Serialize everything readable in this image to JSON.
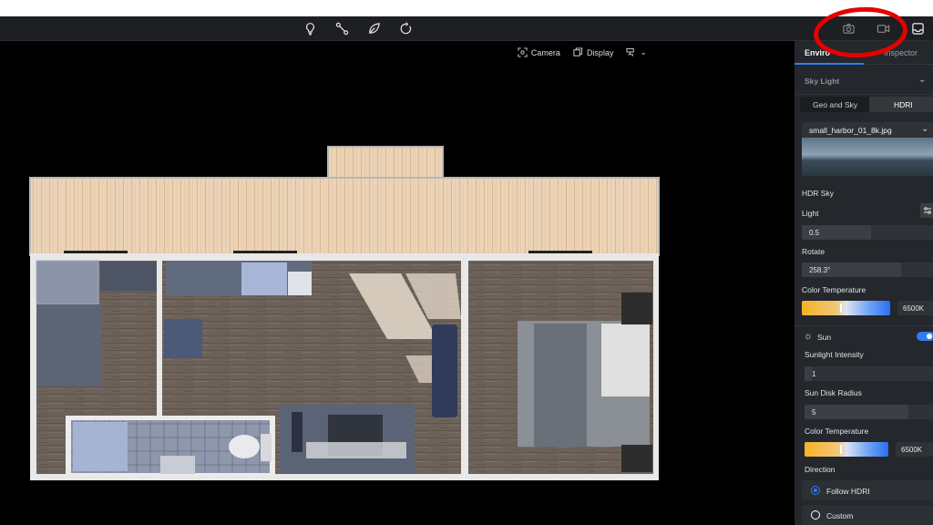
{
  "toolbar": {
    "icons": [
      "lightbulb-icon",
      "path-icon",
      "leaf-icon",
      "rotate-icon",
      "camera-icon",
      "video-icon",
      "inbox-icon"
    ]
  },
  "viewport_tools": {
    "camera_label": "Camera",
    "display_label": "Display"
  },
  "panel": {
    "tab_environment": "Enviro",
    "tab_inspector": "Inspector",
    "sky_light": {
      "title": "Sky Light",
      "subtab_geo": "Geo and Sky",
      "subtab_hdri": "HDRI",
      "hdri_file": "small_harbor_01_8k.jpg",
      "hdr_sky_label": "HDR Sky",
      "light_label": "Light",
      "light_value": "0.5",
      "light_fraction": 0.5,
      "rotate_label": "Rotate",
      "rotate_value": "258.3°",
      "rotate_fraction": 0.72,
      "color_temp_label": "Color Temperature",
      "color_temp_value": "6500K",
      "color_temp_fraction": 0.44
    },
    "sun": {
      "title": "Sun",
      "enabled": true,
      "intensity_label": "Sunlight Intensity",
      "intensity_value": "1",
      "intensity_fraction": 0.05,
      "disk_radius_label": "Sun Disk Radius",
      "disk_radius_value": "5",
      "disk_radius_fraction": 0.75,
      "color_temp_label": "Color Temperature",
      "color_temp_value": "6500K",
      "color_temp_fraction": 0.44,
      "direction_label": "Direction",
      "option_follow": "Follow HDRI",
      "option_custom": "Custom",
      "selected_option": "Follow HDRI"
    }
  },
  "colors": {
    "accent": "#2f7df6",
    "annotation": "#e60000",
    "panel_bg": "#24272b",
    "topbar_bg": "#1d1f22"
  }
}
